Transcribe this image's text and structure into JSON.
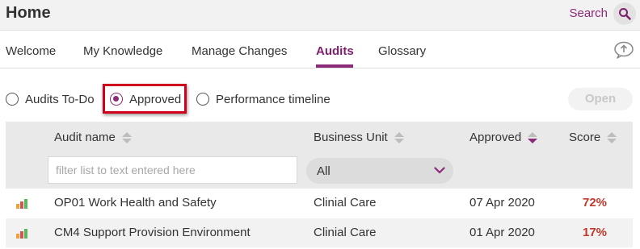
{
  "header": {
    "title": "Home",
    "search_label": "Search"
  },
  "tabs": [
    {
      "label": "Welcome",
      "active": false
    },
    {
      "label": "My Knowledge",
      "active": false
    },
    {
      "label": "Manage Changes",
      "active": false
    },
    {
      "label": "Audits",
      "active": true
    },
    {
      "label": "Glossary",
      "active": false
    }
  ],
  "view_options": {
    "options": [
      {
        "label": "Audits To-Do",
        "selected": false
      },
      {
        "label": "Approved",
        "selected": true
      },
      {
        "label": "Performance timeline",
        "selected": false
      }
    ],
    "open_label": "Open"
  },
  "table": {
    "columns": [
      "Audit name",
      "Business Unit",
      "Approved",
      "Score"
    ],
    "sorted_column": "Approved",
    "filter_placeholder": "filter list to text entered here",
    "business_unit_selected": "All",
    "rows": [
      {
        "name": "OP01 Work Health and Safety",
        "business_unit": "Clinial Care",
        "approved": "07 Apr 2020",
        "score": "72%"
      },
      {
        "name": "CM4 Support Provision Environment",
        "business_unit": "Clinial Care",
        "approved": "01 Apr 2020",
        "score": "17%"
      }
    ]
  },
  "colors": {
    "accent": "#8b2a78",
    "score_text": "#c0392b",
    "highlight": "#d0021b"
  }
}
